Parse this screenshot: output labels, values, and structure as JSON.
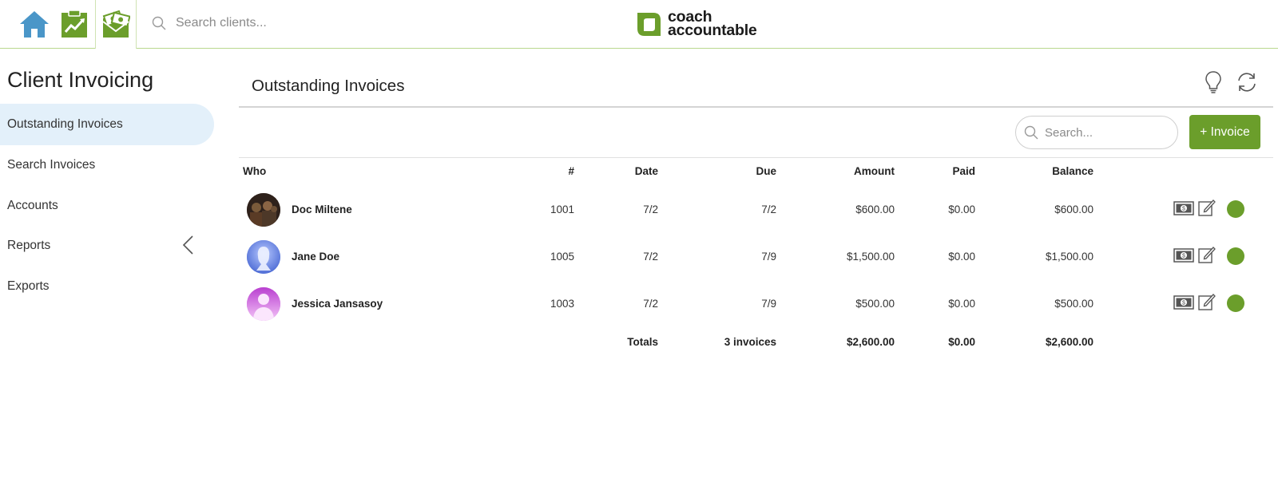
{
  "topbar": {
    "nav": [
      {
        "icon": "home-icon"
      },
      {
        "icon": "progress-clipboard-icon"
      },
      {
        "icon": "invoice-money-icon"
      }
    ],
    "client_search_placeholder": "Search clients...",
    "logo": {
      "line1": "coach",
      "line2": "accountable"
    }
  },
  "sidebar": {
    "title": "Client Invoicing",
    "items": [
      {
        "label": "Outstanding Invoices",
        "active": true
      },
      {
        "label": "Search Invoices",
        "active": false
      },
      {
        "label": "Accounts",
        "active": false
      },
      {
        "label": "Reports",
        "active": false
      },
      {
        "label": "Exports",
        "active": false
      }
    ]
  },
  "main": {
    "title": "Outstanding Invoices",
    "search_placeholder": "Search...",
    "add_button": "+ Invoice",
    "table": {
      "headers": {
        "who": "Who",
        "number": "#",
        "date": "Date",
        "due": "Due",
        "amount": "Amount",
        "paid": "Paid",
        "balance": "Balance"
      },
      "rows": [
        {
          "name": "Doc Miltene",
          "number": "1001",
          "date": "7/2",
          "due": "7/2",
          "amount": "$600.00",
          "paid": "$0.00",
          "balance": "$600.00"
        },
        {
          "name": "Jane Doe",
          "number": "1005",
          "date": "7/2",
          "due": "7/9",
          "amount": "$1,500.00",
          "paid": "$0.00",
          "balance": "$1,500.00"
        },
        {
          "name": "Jessica Jansasoy",
          "number": "1003",
          "date": "7/2",
          "due": "7/9",
          "amount": "$500.00",
          "paid": "$0.00",
          "balance": "$500.00"
        }
      ],
      "totals": {
        "label": "Totals",
        "count": "3 invoices",
        "amount": "$2,600.00",
        "paid": "$0.00",
        "balance": "$2,600.00"
      }
    }
  },
  "colors": {
    "brand_green": "#6b9e2b",
    "home_blue": "#4a96c8",
    "active_bg": "#e3f0fa",
    "status_green": "#6b9e2b"
  }
}
